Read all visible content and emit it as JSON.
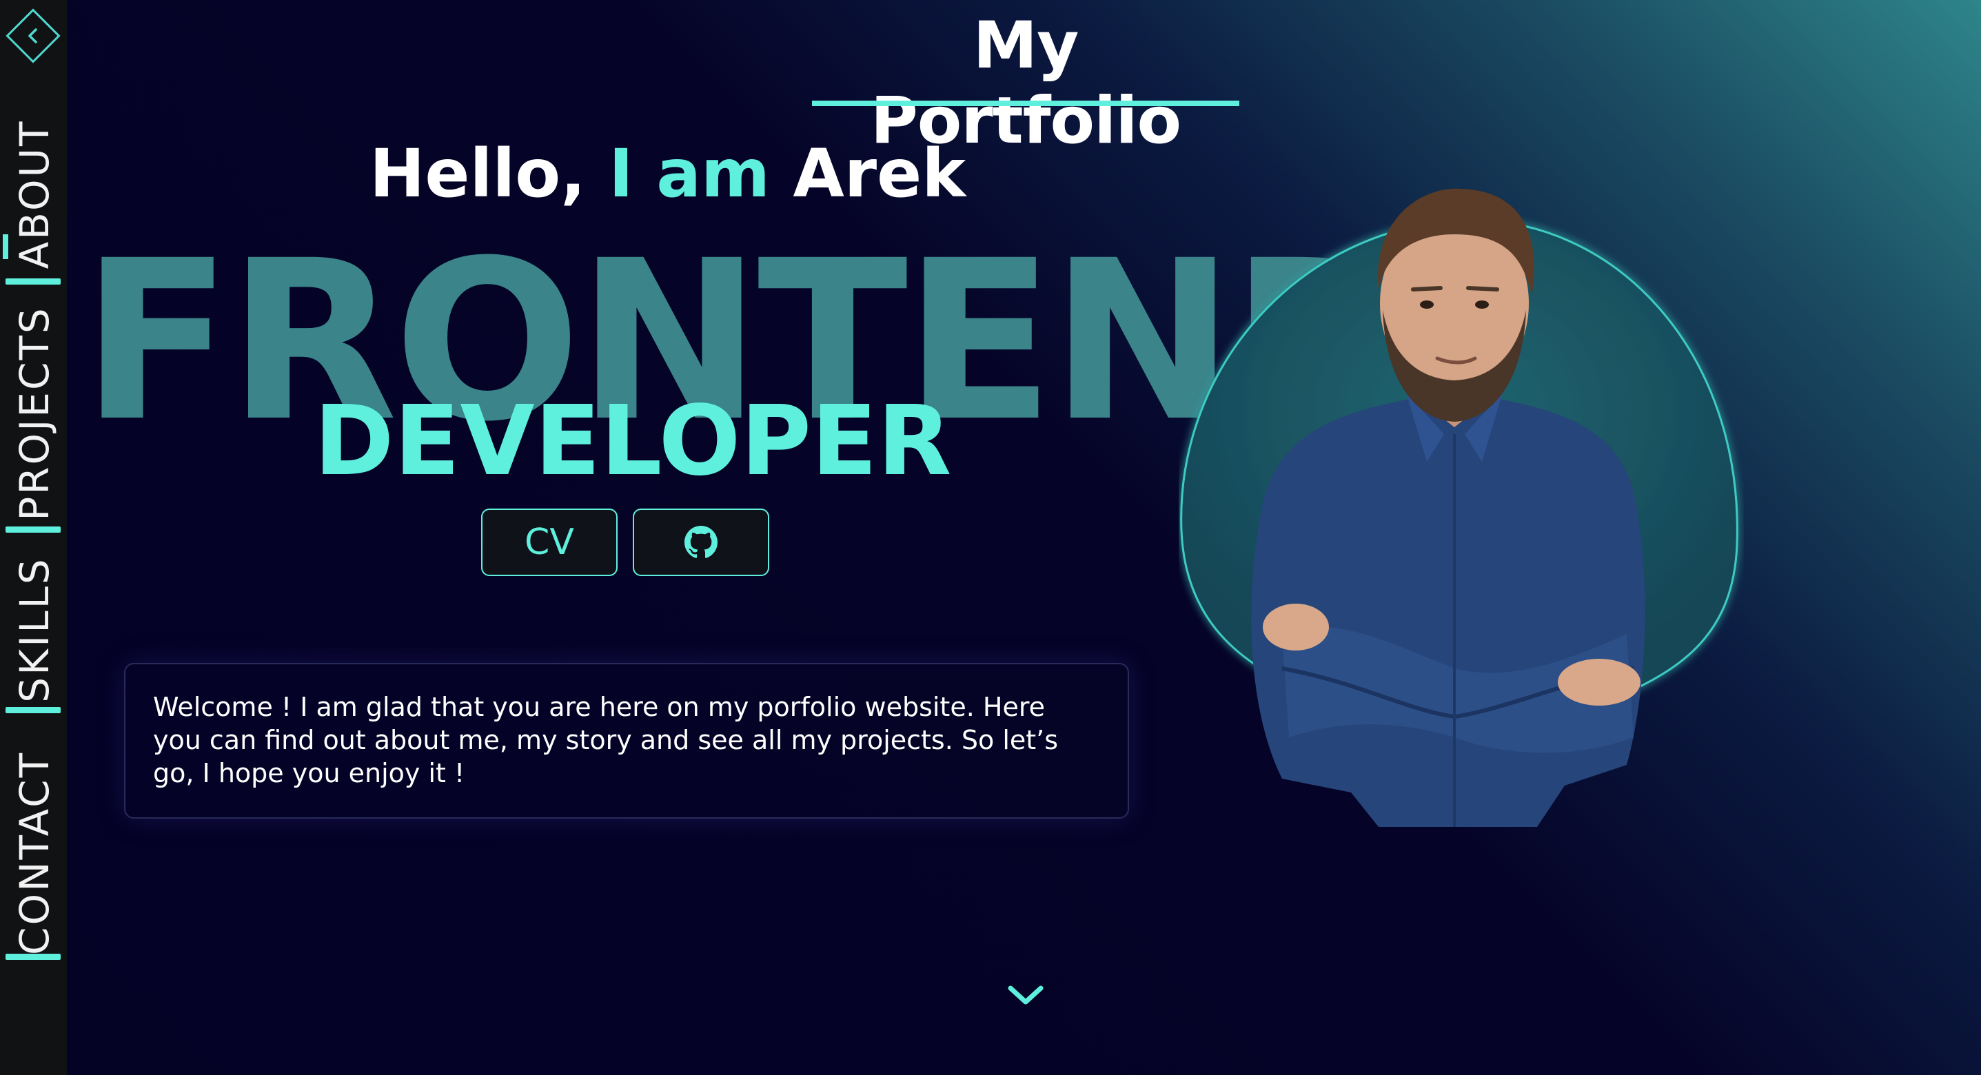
{
  "sidebar": {
    "back_icon": "chevron-left-icon",
    "items": [
      {
        "label": "ABOUT"
      },
      {
        "label": "PROJECTS"
      },
      {
        "label": "SKILLS"
      },
      {
        "label": "CONTACT"
      }
    ]
  },
  "header": {
    "title": "My Portfolio"
  },
  "hero": {
    "greeting_hello": "Hello,",
    "greeting_iam": "I am",
    "greeting_name": "Arek",
    "role_main": "FRONTEND",
    "role_sub": "DEVELOPER",
    "cv_button_label": "CV",
    "github_icon": "github-icon"
  },
  "intro": {
    "text": "Welcome ! I am glad that you are here on my porfolio website. Here you can find out about me, my story and see all my projects. So let’s go, I hope you enjoy it !"
  },
  "scroll": {
    "icon": "chevron-down-icon"
  },
  "colors": {
    "accent": "#5ff0dd",
    "background": "#050326",
    "sidebar": "#111214",
    "frontend_text": "#3a848a"
  }
}
